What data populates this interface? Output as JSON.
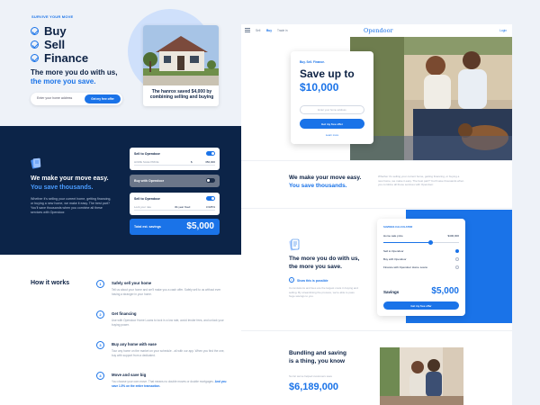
{
  "left_top": {
    "eyebrow": "SURVIVE YOUR MOVE",
    "checks": [
      "Buy",
      "Sell",
      "Finance"
    ],
    "headline_1": "The more you do with us,",
    "headline_2": "the more you save.",
    "address_placeholder": "Enter your home address",
    "address_button": "Get my free offer",
    "house_caption": "The hanrox saved $4,000 by combining selling and buying"
  },
  "navy": {
    "headline_1": "We make your move easy.",
    "headline_2": "You save thousands.",
    "paragraph": "Whether it's selling your current home, getting financing, or buying a new home, we make it easy. The best part? You'll save thousands when you combine all these services with Opendoor.",
    "card1": {
      "label": "Sell to Opendoor",
      "sub_label": "HOME SALE PRICE",
      "sub_currency": "$",
      "sub_value": "350,000"
    },
    "card2": {
      "label": "Buy with Opendoor"
    },
    "card3": {
      "label": "Sell to Opendoor",
      "sub_label": "Lock your rate",
      "sub_term": "30-year fixed",
      "sub_value": "3.625%"
    },
    "savings_label": "Total est. savings",
    "savings_value": "$5,000"
  },
  "how_it_works": {
    "title": "How it works",
    "steps": [
      {
        "num": "1",
        "title": "Safely sell your home",
        "desc": "Tell us about your home and we'll make you a cash offer. Safely sell to us without ever having a stranger in your home."
      },
      {
        "num": "2",
        "title": "Get financing",
        "desc": "Use with Opendoor Home Loans to lock in a low rate, avoid lender fees, and unlock your buying power."
      },
      {
        "num": "3",
        "title": "Buy any home with ease",
        "desc": "Tour any home on the market on your schedule - all with our app. When you find the one, buy with support from a dedicated."
      },
      {
        "num": "4",
        "title": "Move and save big",
        "desc": "You choose your own move. That means no double moves or double mortgages.",
        "desc_highlight": "And you save 1.5% on the entire transaction."
      }
    ]
  },
  "right_page": {
    "nav": {
      "items": [
        "Sell",
        "Buy",
        "Trade in"
      ],
      "logo": "Opendoor",
      "login": "Login"
    },
    "hero": {
      "eyebrow": "Buy. Sell. Finance.",
      "title_1": "Save up to",
      "title_2": "$10,000",
      "input_placeholder": "Enter your home address",
      "button": "Get my free offer",
      "link": "Learn more"
    },
    "section2": {
      "headline_1": "We make your move easy.",
      "headline_2": "You save thousands.",
      "paragraph": "Whether it's selling your current home, getting financing, or buying a new home, we make it easy. The best part? You'll save thousands when you combine all these services with Opendoor."
    },
    "section3": {
      "headline_1": "The more you do with us,",
      "headline_2": "the more you save.",
      "sub_num": "1",
      "sub_title": "Show this is possible",
      "paragraph": "Commissions and fees are the largest costs in buying and selling. By streamlining the process, we're able to pass huge savings to you.",
      "calc": {
        "title": "SAVINGS CALCULATOR",
        "price_label": "Home sale price",
        "price_value": "$400,000",
        "price_level": 0.62,
        "options": [
          "Sell to Opendoor",
          "Buy with Opendoor",
          "Finance with Opendoor Home Loans"
        ],
        "options_on": [
          true,
          false,
          false
        ],
        "savings_label": "Savings",
        "savings_value": "$5,000",
        "button": "Get my free offer"
      }
    },
    "section4": {
      "headline_1": "Bundling and saving",
      "headline_2": "is a thing, you know",
      "paragraph": "So far we've helped customers save",
      "value": "$6,189,000"
    }
  },
  "colors": {
    "navy": "#0c2448",
    "accent": "#1a73e8",
    "pale": "#eef2f8"
  }
}
